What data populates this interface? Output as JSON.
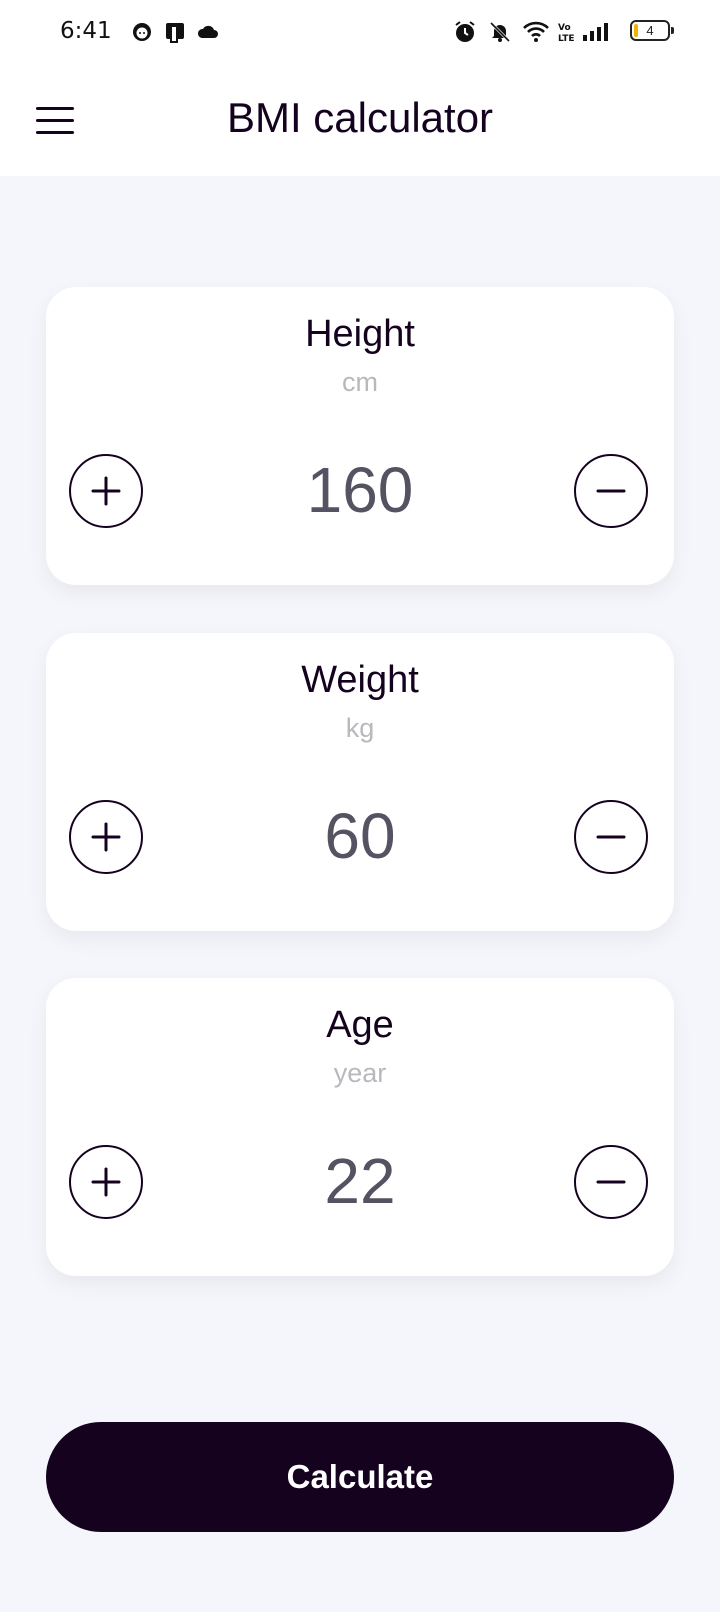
{
  "status_bar": {
    "time": "6:41",
    "battery_level": "4",
    "icons": [
      "face-icon",
      "sim-icon",
      "cloud-icon",
      "alarm-icon",
      "mute-icon",
      "wifi-icon",
      "volte-icon",
      "signal-icon",
      "battery-icon"
    ]
  },
  "app_bar": {
    "title": "BMI calculator",
    "menu_icon": "hamburger-menu-icon"
  },
  "cards": [
    {
      "title": "Height",
      "unit": "cm",
      "value": "160"
    },
    {
      "title": "Weight",
      "unit": "kg",
      "value": "60"
    },
    {
      "title": "Age",
      "unit": "year",
      "value": "22"
    }
  ],
  "buttons": {
    "increment_icon": "plus-icon",
    "decrement_icon": "minus-icon",
    "calculate_label": "Calculate"
  },
  "colors": {
    "primary": "#14021f",
    "background": "#f5f6fb",
    "card": "#ffffff",
    "value_text": "#555362",
    "unit_text": "#b8b8bd"
  }
}
